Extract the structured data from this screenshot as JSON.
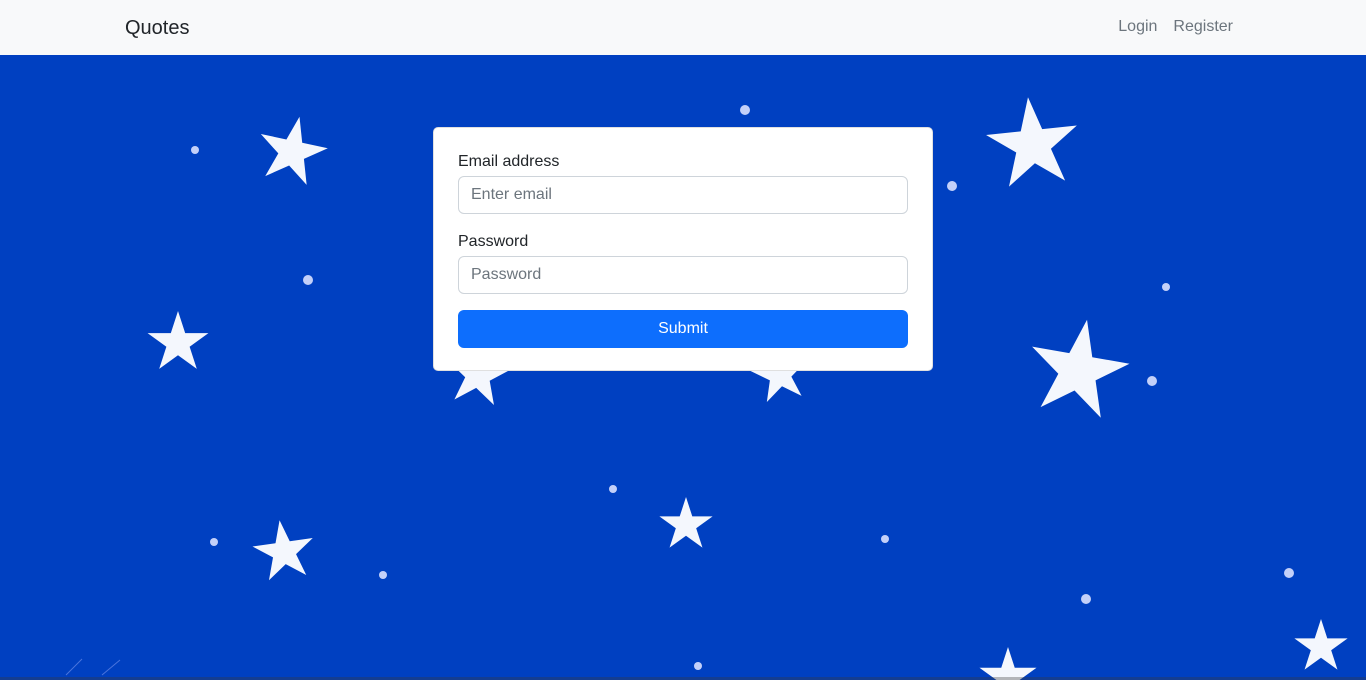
{
  "navbar": {
    "brand": "Quotes",
    "links": [
      {
        "label": "Login"
      },
      {
        "label": "Register"
      }
    ]
  },
  "form": {
    "email": {
      "label": "Email address",
      "placeholder": "Enter email",
      "value": ""
    },
    "password": {
      "label": "Password",
      "placeholder": "Password",
      "value": ""
    },
    "submit_label": "Submit"
  },
  "colors": {
    "background": "#0040c1",
    "navbar": "#f8f9fa",
    "primary": "#0d6efd",
    "star": "#ffffff"
  }
}
